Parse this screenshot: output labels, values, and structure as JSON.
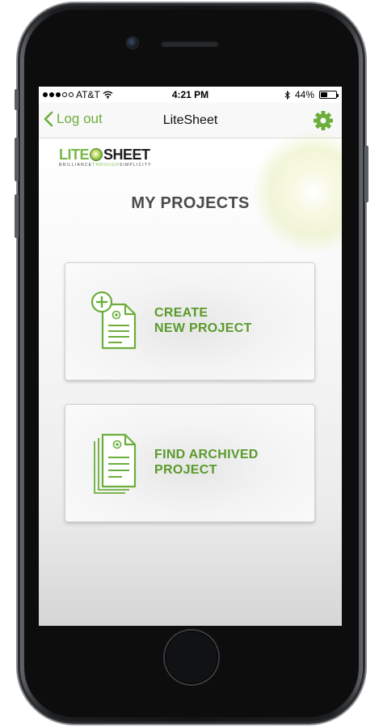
{
  "status_bar": {
    "carrier": "AT&T",
    "time": "4:21 PM",
    "battery_percent": "44%",
    "battery_level": 0.44,
    "signal_bars_filled": 3,
    "signal_bars_total": 5
  },
  "nav": {
    "back_label": "Log out",
    "title": "LiteSheet"
  },
  "logo": {
    "word_part1": "LITE",
    "word_part2": "SHEET",
    "tagline_part1": "BRILLIANCE",
    "tagline_part2": "THROUGH",
    "tagline_part3": "SIMPLICITY"
  },
  "page_title": "MY PROJECTS",
  "actions": {
    "create": {
      "line1": "CREATE",
      "line2": "NEW PROJECT"
    },
    "find": {
      "line1": "FIND ARCHIVED",
      "line2": "PROJECT"
    }
  },
  "colors": {
    "accent": "#6cae3c",
    "label_green": "#5a9a2c",
    "title_gray": "#4a4a4a"
  },
  "icons": {
    "back": "chevron-left-icon",
    "settings": "gear-icon",
    "create": "new-document-plus-icon",
    "find": "document-stack-icon",
    "wifi": "wifi-icon",
    "bluetooth": "bluetooth-icon",
    "battery": "battery-icon"
  }
}
